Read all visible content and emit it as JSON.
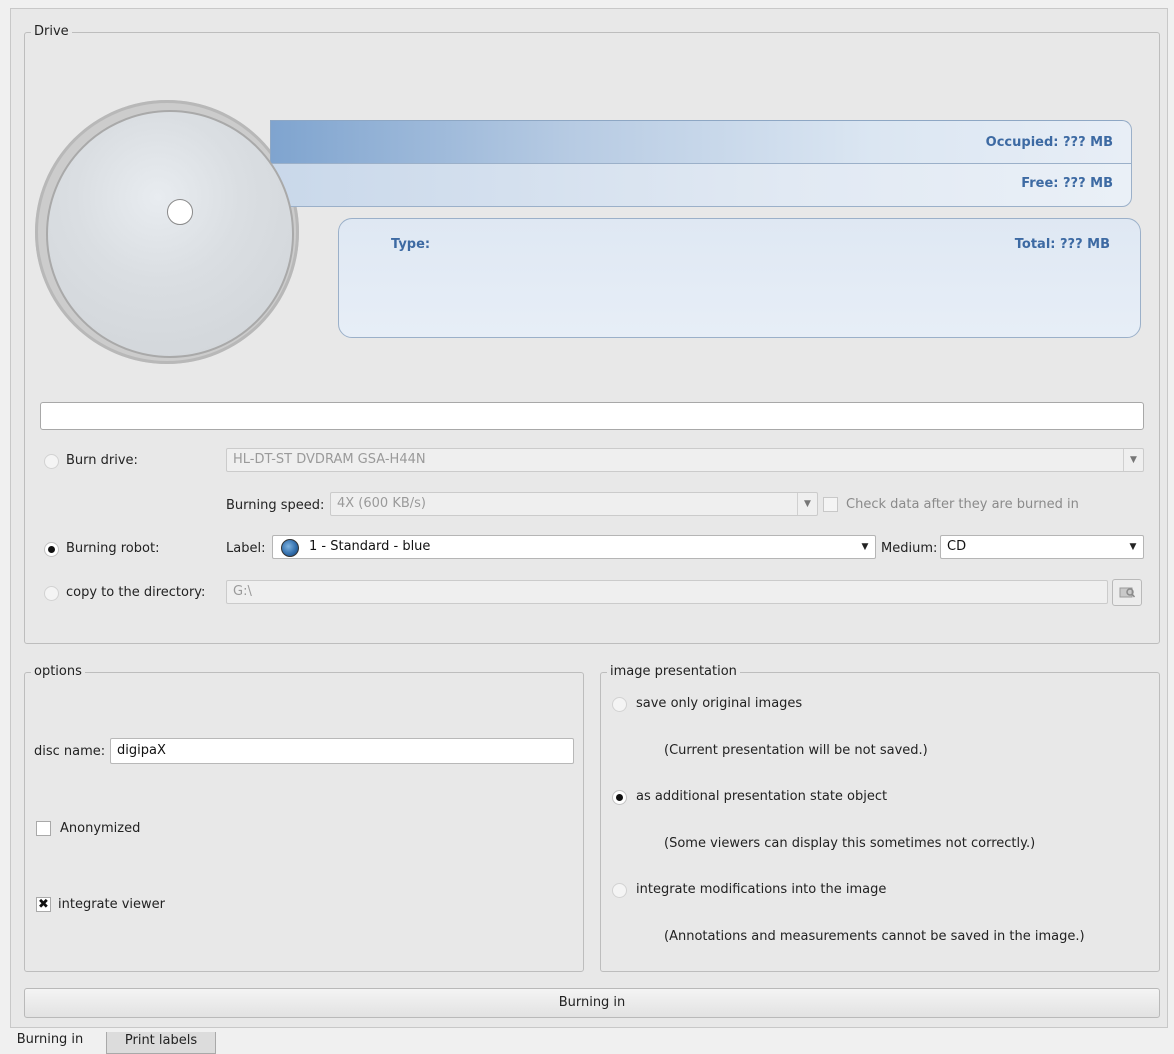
{
  "drive": {
    "group_title": "Drive",
    "occupied": "Occupied: ??? MB",
    "free": "Free: ??? MB",
    "type": "Type:",
    "total": "Total: ??? MB",
    "progress": 0
  },
  "burn_drive": {
    "label": "Burn drive:",
    "value": "HL-DT-ST DVDRAM GSA-H44N",
    "speed_label": "Burning speed:",
    "speed_value": "4X (600 KB/s)",
    "check_label": "Check data after they are burned in",
    "checked": false
  },
  "robot": {
    "label": "Burning robot:",
    "label_caption": "Label:",
    "label_value": "1 - Standard - blue",
    "medium_caption": "Medium:",
    "medium_value": "CD"
  },
  "copy_dir": {
    "label": "copy to the directory:",
    "value": "G:\\"
  },
  "options": {
    "group_title": "options",
    "disc_name_label": "disc name:",
    "disc_name_value": "digipaX",
    "anonymized_label": "Anonymized",
    "anonymized_checked": false,
    "integrate_viewer_label": "integrate viewer",
    "integrate_viewer_checked": true
  },
  "image_presentation": {
    "group_title": "image presentation",
    "opt1": "save only original images",
    "opt1_note": "(Current presentation will be not saved.)",
    "opt2": "as additional presentation state object",
    "opt2_note": "(Some viewers can display this sometimes not correctly.)",
    "opt3": "integrate modifications into the image",
    "opt3_note": "(Annotations and measurements cannot be saved in the image.)",
    "selected": "opt2"
  },
  "actions": {
    "burn_button": "Burning in"
  },
  "tabs": [
    {
      "label": "Burning in",
      "active": true
    },
    {
      "label": "Print labels",
      "active": false
    }
  ]
}
